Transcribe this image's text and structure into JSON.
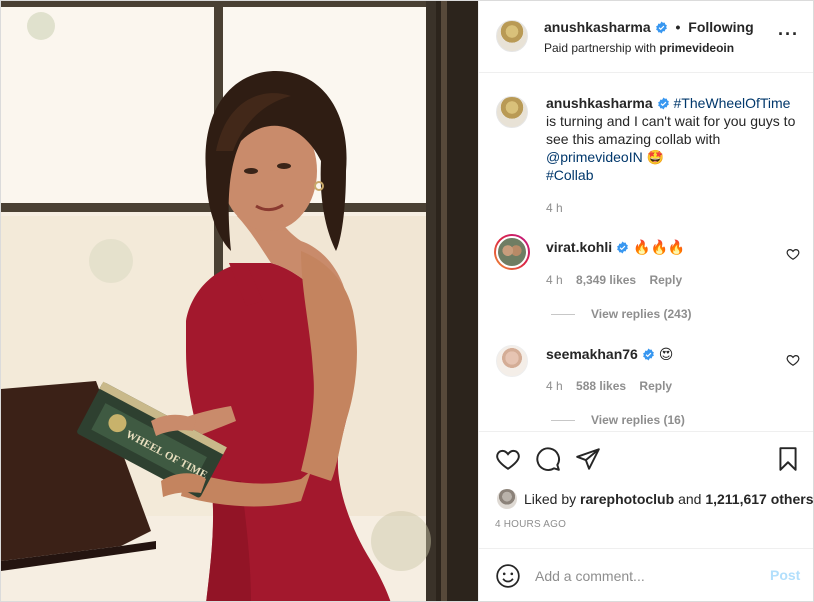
{
  "post": {
    "photo_alt": "Woman in red dress holding The Wheel of Time book",
    "book_title": "WHEEL OF TIME"
  },
  "header": {
    "username": "anushkasharma",
    "separator": "•",
    "follow_label": "Following",
    "paid_prefix": "Paid partnership with",
    "partner": "primevideoin",
    "more_icon": "more-horizontal-icon"
  },
  "caption": {
    "username": "anushkasharma",
    "hashtag1": "#TheWheelOfTime",
    "text": "is turning and I can't wait for you guys to see this amazing collab with",
    "mention": "@primevideoIN",
    "emoji": "🤩",
    "hashtag2": "#Collab",
    "time": "4 h"
  },
  "comments": [
    {
      "username": "virat.kohli",
      "text": "🔥🔥🔥",
      "time": "4 h",
      "likes": "8,349 likes",
      "reply_label": "Reply",
      "view_replies": "View replies (243)"
    },
    {
      "username": "seemakhan76",
      "text": "😍",
      "time": "4 h",
      "likes": "588 likes",
      "reply_label": "Reply",
      "view_replies": "View replies (16)"
    }
  ],
  "likes": {
    "prefix": "Liked by",
    "user": "rarephotoclub",
    "conj": "and",
    "others": "1,211,617 others"
  },
  "posted_time": "4 HOURS AGO",
  "composer": {
    "placeholder": "Add a comment...",
    "post_label": "Post"
  },
  "colors": {
    "link": "#00376b",
    "verified": "#3897f0",
    "post_disabled": "#b2dffc",
    "dress": "#a3182d"
  }
}
